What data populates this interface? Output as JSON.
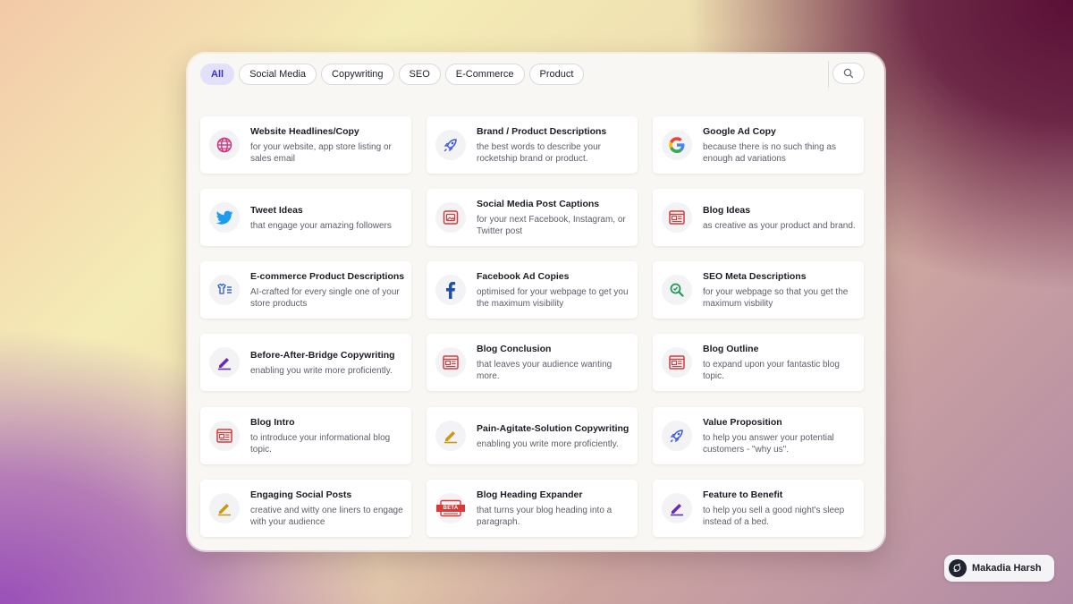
{
  "filters": {
    "tabs": [
      "All",
      "Social Media",
      "Copywriting",
      "SEO",
      "E-Commerce",
      "Product"
    ],
    "active": "All",
    "search_icon": "search-icon"
  },
  "cards": [
    {
      "title": "Website Headlines/Copy",
      "desc": "for your website, app store listing or sales email",
      "icon": "globe-icon"
    },
    {
      "title": "Brand / Product Descriptions",
      "desc": "the best words to describe your rocketship brand or product.",
      "icon": "rocket-icon"
    },
    {
      "title": "Google Ad Copy",
      "desc": "because there is no such thing as enough ad variations",
      "icon": "google-icon"
    },
    {
      "title": "Tweet Ideas",
      "desc": "that engage your amazing followers",
      "icon": "twitter-icon"
    },
    {
      "title": "Social Media Post Captions",
      "desc": "for your next Facebook, Instagram, or Twitter post",
      "icon": "image-icon"
    },
    {
      "title": "Blog Ideas",
      "desc": "as creative as your product and brand.",
      "icon": "newspaper-icon"
    },
    {
      "title": "E-commerce Product Descriptions",
      "desc": "AI-crafted for every single one of your store products",
      "icon": "tshirt-list-icon"
    },
    {
      "title": "Facebook Ad Copies",
      "desc": "optimised for your webpage to get you the maximum visibility",
      "icon": "facebook-icon"
    },
    {
      "title": "SEO Meta Descriptions",
      "desc": "for your webpage so that you get the maximum visbility",
      "icon": "seo-search-icon"
    },
    {
      "title": "Before-After-Bridge Copywriting",
      "desc": "enabling you write more proficiently.",
      "icon": "pen-purple-icon"
    },
    {
      "title": "Blog Conclusion",
      "desc": "that leaves your audience wanting more.",
      "icon": "newspaper-icon"
    },
    {
      "title": "Blog Outline",
      "desc": "to expand upon your fantastic blog topic.",
      "icon": "newspaper-icon"
    },
    {
      "title": "Blog Intro",
      "desc": "to introduce your informational blog topic.",
      "icon": "newspaper-icon"
    },
    {
      "title": "Pain-Agitate-Solution Copywriting",
      "desc": "enabling you write more proficiently.",
      "icon": "pen-gold-icon"
    },
    {
      "title": "Value Proposition",
      "desc": "to help you answer your potential customers - \"why us\".",
      "icon": "rocket-icon"
    },
    {
      "title": "Engaging Social Posts",
      "desc": "creative and witty one liners to engage with your audience",
      "icon": "pen-gold-icon"
    },
    {
      "title": "Blog Heading Expander",
      "desc": "that turns your blog heading into a paragraph.",
      "icon": "beta-icon",
      "badge": "BETA"
    },
    {
      "title": "Feature to Benefit",
      "desc": "to help you sell a good night's sleep instead of a bed.",
      "icon": "pen-purple-icon"
    }
  ],
  "author": {
    "name": "Makadia Harsh",
    "icon": "bird-icon"
  },
  "colors": {
    "accent": "#3a2fc4",
    "chip_active_bg": "#e2e0fb",
    "pink": "#d62f7a",
    "red": "#d63a3a",
    "blue": "#3d5bd9"
  }
}
